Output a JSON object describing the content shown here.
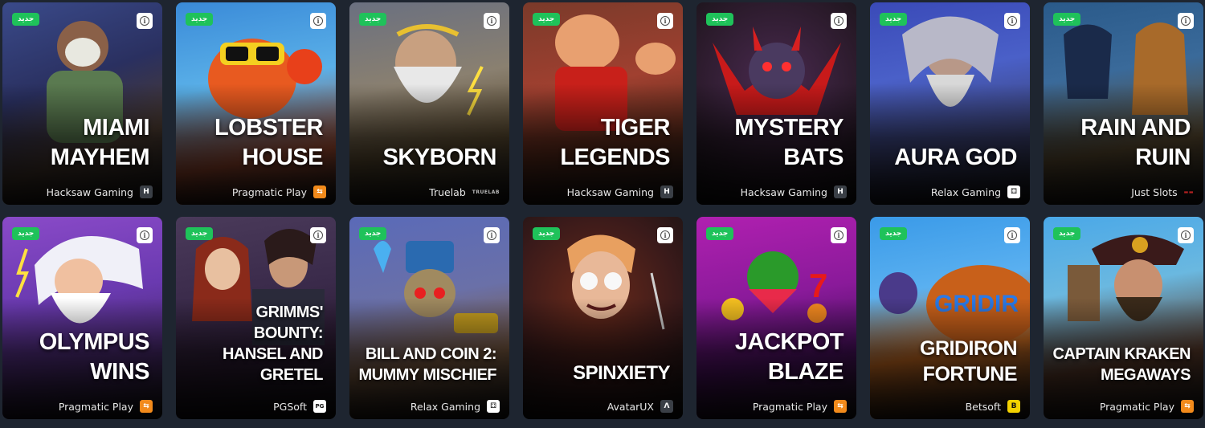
{
  "badge_label": "جديد",
  "info_glyph": "i",
  "row1": [
    {
      "title_lines": [
        "MIAMI",
        "MAYHEM"
      ],
      "provider": "Hacksaw Gaming",
      "logo": "H",
      "logo_kind": "hack"
    },
    {
      "title_lines": [
        "LOBSTER",
        "HOUSE"
      ],
      "provider": "Pragmatic Play",
      "logo": "⇆",
      "logo_kind": "prag"
    },
    {
      "title_lines": [
        "SKYBORN",
        ""
      ],
      "provider": "Truelab",
      "logo": "TRUELAB",
      "logo_kind": "text"
    },
    {
      "title_lines": [
        "TIGER",
        "LEGENDS"
      ],
      "provider": "Hacksaw Gaming",
      "logo": "H",
      "logo_kind": "hack"
    },
    {
      "title_lines": [
        "MYSTERY",
        "BATS"
      ],
      "provider": "Hacksaw Gaming",
      "logo": "H",
      "logo_kind": "hack"
    },
    {
      "title_lines": [
        "AURA GOD",
        ""
      ],
      "provider": "Relax Gaming",
      "logo": "⚃",
      "logo_kind": "relax"
    },
    {
      "title_lines": [
        "RAIN AND",
        "RUIN"
      ],
      "provider": "Just Slots",
      "logo": "▬▬",
      "logo_kind": "text"
    }
  ],
  "row2": [
    {
      "title_lines": [
        "OLYMPUS",
        "WINS"
      ],
      "provider": "Pragmatic Play",
      "logo": "⇆",
      "logo_kind": "prag"
    },
    {
      "title_lines": [
        "GRIMMS' BOUNTY:",
        "HANSEL AND GRETEL"
      ],
      "provider": "PGSoft",
      "logo": "PG",
      "logo_kind": "pg"
    },
    {
      "title_lines": [
        "BILL AND COIN 2:",
        "MUMMY MISCHIEF"
      ],
      "provider": "Relax Gaming",
      "logo": "⚃",
      "logo_kind": "relax"
    },
    {
      "title_lines": [
        "SPINXIETY",
        ""
      ],
      "provider": "AvatarUX",
      "logo": "Λ",
      "logo_kind": "avatar"
    },
    {
      "title_lines": [
        "JACKPOT",
        "BLAZE"
      ],
      "provider": "Pragmatic Play",
      "logo": "⇆",
      "logo_kind": "prag"
    },
    {
      "title_lines": [
        "GRIDIRON",
        "FORTUNE"
      ],
      "provider": "Betsoft",
      "logo": "B",
      "logo_kind": "bets"
    },
    {
      "title_lines": [
        "CAPTAIN KRAKEN",
        "MEGAWAYS"
      ],
      "provider": "Pragmatic Play",
      "logo": "⇆",
      "logo_kind": "prag"
    }
  ],
  "colors": {
    "page_bg": "#1e2530",
    "badge_bg": "#1fc25a",
    "prag_logo": "#f28a1b",
    "betsoft_logo": "#f4d200"
  }
}
